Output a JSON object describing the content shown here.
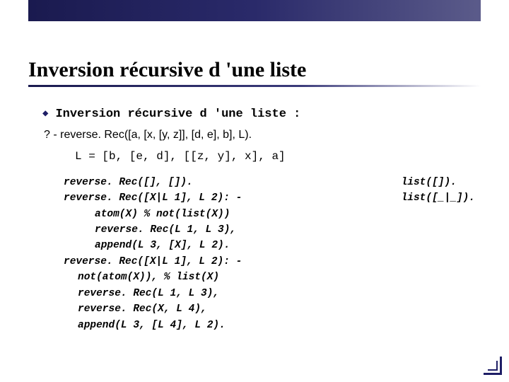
{
  "title": "Inversion récursive d 'une liste",
  "bullet_label": "Inversion récursive d 'une liste :",
  "query": "? - reverse. Rec([a, [x, [y, z]], [d, e], b], L).",
  "result": "L = [b, [e, d], [[z, y], x], a]",
  "code": [
    "reverse. Rec([], []).",
    "reverse. Rec([X|L 1], L 2): -",
    "atom(X) % not(list(X))",
    "reverse. Rec(L 1, L 3),",
    "append(L 3, [X], L 2).",
    "reverse. Rec([X|L 1], L 2): -",
    "not(atom(X)), % list(X)",
    "reverse. Rec(L 1, L 3),",
    "reverse. Rec(X, L 4),",
    "append(L 3, [L 4], L 2)."
  ],
  "side_note": {
    "line1": "list([]).",
    "line2": "list([_|_])."
  }
}
